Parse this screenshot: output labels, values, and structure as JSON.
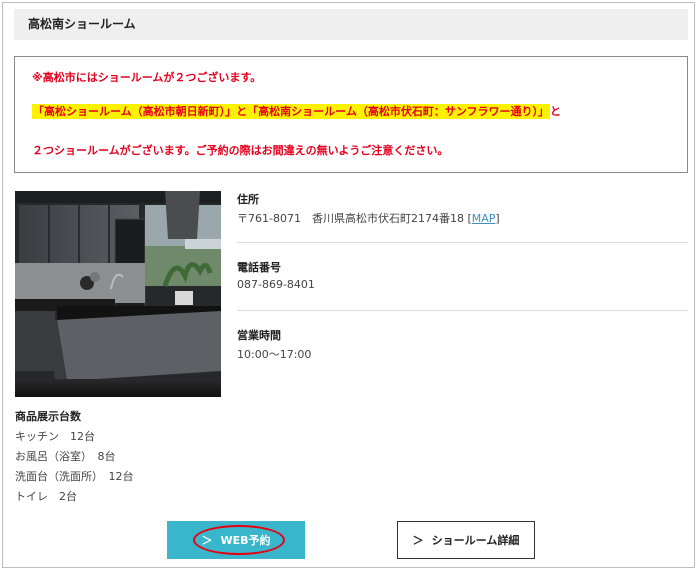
{
  "header": {
    "title": "高松南ショールーム"
  },
  "notice": {
    "line1": "※高松市にはショールームが２つございます。",
    "line2_highlight": "「高松ショールーム（高松市朝日新町）」と「高松南ショールーム（高松市伏石町：サンフラワー通り）」",
    "line2_tail": "と",
    "line3": "２つショールームがございます。ご予約の際はお間違えの無いようご注意ください。"
  },
  "address": {
    "label": "住所",
    "value": "〒761-8071　香川県高松市伏石町2174番18",
    "map_open": "[",
    "map_link": "MAP",
    "map_close": "]"
  },
  "phone": {
    "label": "電話番号",
    "value": "087-869-8401"
  },
  "hours": {
    "label": "営業時間",
    "value": "10:00〜17:00"
  },
  "product_counts": {
    "heading": "商品展示台数",
    "items": [
      "キッチン　12台",
      "お風呂（浴室）　8台",
      "洗面台（洗面所）　12台",
      "トイレ　2台"
    ]
  },
  "buttons": {
    "web_reserve": "WEB予約",
    "showroom_detail": "ショールーム詳細",
    "chevron": "＞"
  },
  "colors": {
    "alert": "#e6001e",
    "highlight": "#fff200",
    "accent": "#39b6cc",
    "circle": "#e60012"
  }
}
